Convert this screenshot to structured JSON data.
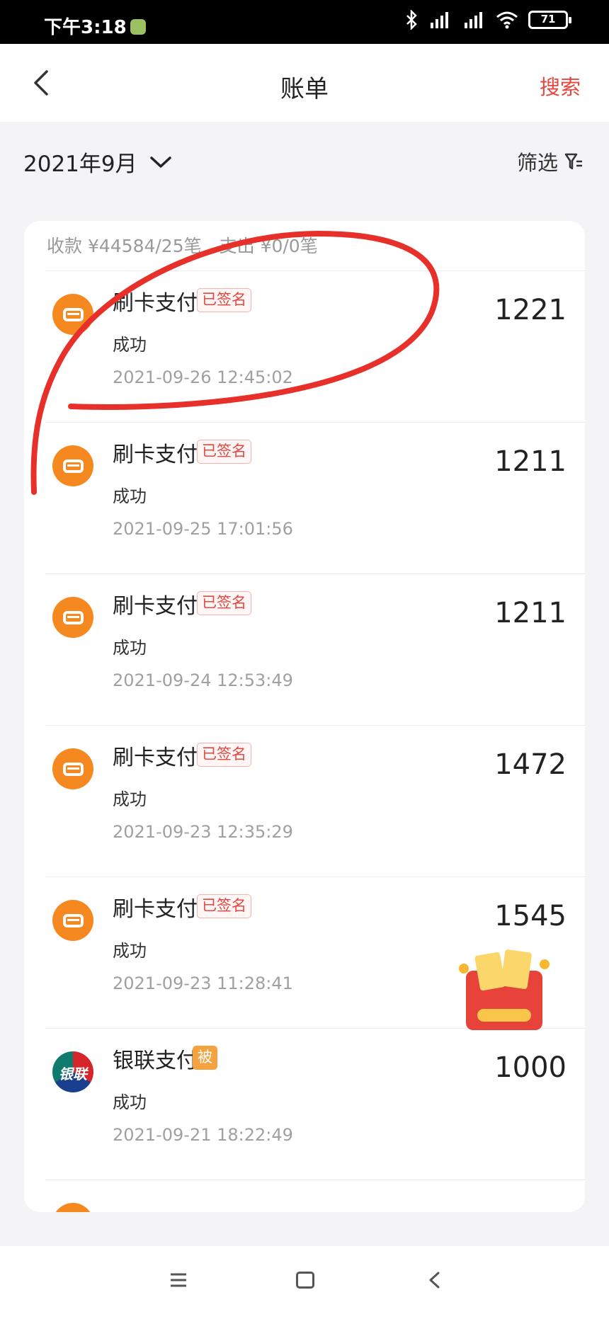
{
  "status_bar": {
    "time": "下午3:18",
    "battery": "71"
  },
  "nav": {
    "title": "账单",
    "search_label": "搜索"
  },
  "filter": {
    "month": "2021年9月",
    "filter_label": "筛选"
  },
  "summary": "收款 ¥44584/25笔　支出 ¥0/0笔",
  "transactions": [
    {
      "name": "刷卡支付",
      "badge": "已签名",
      "status": "成功",
      "time": "2021-09-26 12:45:02",
      "amount": "1221",
      "icon": "card-payment-icon"
    },
    {
      "name": "刷卡支付",
      "badge": "已签名",
      "status": "成功",
      "time": "2021-09-25 17:01:56",
      "amount": "1211",
      "icon": "card-payment-icon"
    },
    {
      "name": "刷卡支付",
      "badge": "已签名",
      "status": "成功",
      "time": "2021-09-24 12:53:49",
      "amount": "1211",
      "icon": "card-payment-icon"
    },
    {
      "name": "刷卡支付",
      "badge": "已签名",
      "status": "成功",
      "time": "2021-09-23 12:35:29",
      "amount": "1472",
      "icon": "card-payment-icon"
    },
    {
      "name": "刷卡支付",
      "badge": "已签名",
      "status": "成功",
      "time": "2021-09-23 11:28:41",
      "amount": "1545",
      "icon": "card-payment-icon"
    },
    {
      "name": "银联支付",
      "badge": "被",
      "status": "成功",
      "time": "2021-09-21 18:22:49",
      "amount": "1000",
      "icon": "unionpay-icon",
      "icon_text": "银联"
    }
  ],
  "colors": {
    "accent": "#e5473f",
    "card_icon": "#f5891f",
    "annotation": "#e8302a"
  }
}
